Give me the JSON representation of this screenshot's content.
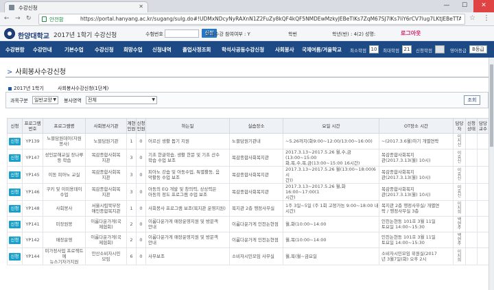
{
  "browser": {
    "tab_title": "수강신청",
    "secure_label": "안전함",
    "url": "https://portal.hanyang.ac.kr/sugang/sulg.do#!UDMxNDcyNyRAXnN1Z2FuZy8kQF4kQF5NMDEwMzkyJEBeTlKs7ZqM67SJ7lKs7liY6rCV7lug7LKtJEBeTTAwOTg4MiRAX",
    "back": "←",
    "forward": "→",
    "reload": "↻",
    "star": "☆",
    "menu": "⋮",
    "minimize": "—",
    "maximize": "☐",
    "close": "✕"
  },
  "header": {
    "university": "한양대학교",
    "semester_title": "2017년 1학기 수강신청",
    "student_no_label": "수험번호",
    "student_no_value": "",
    "confirm_button": "신청",
    "mock_label": "모의수강 참여여부 : Y",
    "college_label": "학번",
    "grade_label": "학년(반) : 4(2)",
    "name_label": "성명:",
    "logout": "로그아웃"
  },
  "mainnav": {
    "items": [
      "수강편람",
      "수강안내",
      "기본수업",
      "수강신청",
      "희망수업",
      "신청내역",
      "졸업사정조회",
      "학석사공동수강신청",
      "사회봉사",
      "국제여름/겨울학교"
    ],
    "min_credit_label": "최소학점",
    "min_credit": "10",
    "max_credit_label": "최대학점",
    "max_credit": "21",
    "applied_label": "신청학점",
    "applied": "",
    "english_label": "영어등급",
    "english": "B등급"
  },
  "page": {
    "title": "사회봉사수강신청",
    "title_arrow": ">",
    "year": "2017년 1학기",
    "sub": "사회봉사수강신청(1단계)",
    "filter1_label": "과목구분",
    "filter1_value": "일반교양",
    "filter2_label": "봉사영역",
    "filter2_value": "전체",
    "query_button": "조회"
  },
  "table": {
    "headers": [
      "신청",
      "프로그램\n번호",
      "프로그램명",
      "사회봉사기관",
      "계현\n인원",
      "신청\n인원",
      "하는일",
      "실습장소",
      "요일 시간",
      "OT장소 시간",
      "담당\n자",
      "신청\n상태",
      "담당\n교수"
    ],
    "apply_label": "신청",
    "rows": [
      {
        "no": "YP139",
        "name": "노블담원데이(자원\n봉사)",
        "org": "노블담원기관",
        "cap": "1",
        "app": "0",
        "task": "어르신 생활 돕기 지원",
        "place": "노블담원기관내",
        "time": "~5.26까지(화9:00~12:00/13:00~16:00)",
        "ot": "~(2017.3.6월)하기 개별연락",
        "mgr": "이\n지\n선"
      },
      {
        "no": "YP147",
        "name": "성인문해교실 장나루\n등 학습",
        "org": "목감종합사회복\n지관",
        "cap": "3",
        "app": "0",
        "task": "기초 한글학습, 생활 한문 및 기초 산수\n학습 수업 보조",
        "place": "목감종합사회복지관",
        "time": "2017.3.13~2017.5.26 월,수,금(13:00~15:00\n화,목,수,목,금(13:00~15:00 16시간)",
        "ot": "목감종합사회복지\n관(2017.3.13(월) 10시)",
        "mgr": "이\n효\n신"
      },
      {
        "no": "YP145",
        "name": "이동 피아노 교실",
        "org": "목감종합사회복\n지관",
        "cap": "3",
        "app": "0",
        "task": "피아노 강습 및 아동수업, 특별활동, 음\n악활동 수업 보조",
        "place": "목감종합사회복지관",
        "time": "2017.3.13~2017.5.26 월(13:00~18:00(6시\n간))",
        "ot": "목감종합사회복지\n관(2017.3.13(월) 10시)",
        "mgr": "이\n효\n신"
      },
      {
        "no": "YP146",
        "name": "쿠키 및 이미용데이\n수업",
        "org": "목감종합사회복\n지관",
        "cap": "3",
        "app": "0",
        "task": "아동의 EQ 개발 및 창의력, 상상력은\n아동의 정도 프로그램 수업 보조",
        "place": "목감종합사회복지관",
        "time": "2017.3.13~2017.5.26 월,화 16:00~17:00(1\n시간)",
        "ot": "목감종합사회복지\n관(2017.3.13(월) 10시)",
        "mgr": "이\n효\n신"
      },
      {
        "no": "YP148",
        "name": "사회봉사",
        "org": "서울시립북부장\n애인종합복지관",
        "cap": "1",
        "app": "0",
        "task": "사회봉사 프로그램 보조(복지관 운영지원)",
        "place": "복지관 2층 행정사무실",
        "time": "1주 3일~5일 (주 1회 고정가능 9:00~18:00 내\n시간)",
        "ot": "복지관 2층 행정사무실/ 개별연\n락 / 행정사무실 3층",
        "mgr": "이\n지\n희"
      },
      {
        "no": "YP141",
        "name": "미장원봉",
        "org": "이룸다운가게(국\n제협회)",
        "cap": "2",
        "app": "0",
        "task": "이룸다운가게 매장운영지원 및 방문객\n안내",
        "place": "이룸다운가게 인천논현점",
        "time": "월,화(10:00~14:00",
        "ot": "인천논현동 101호 3월 11일\n토요일 14:00~15:30",
        "mgr": "백\n현\n주"
      },
      {
        "no": "YP142",
        "name": "매장운영",
        "org": "이룸다운가게(국\n제협회)",
        "cap": "2",
        "app": "0",
        "task": "이룸다운가게 매장운영지원 및 방문객\n안내",
        "place": "이룸다운가게 인천논현점",
        "time": "월,목(10:00~14:00",
        "ot": "인천논현동 101호 3월 11일\n토요일 14:00~15:30",
        "mgr": "백\n현\n주"
      },
      {
        "no": "YP144",
        "name": "미가정사업 프로젝트에\n뉴스기자가지원",
        "org": "안산소비자시민\n모임",
        "cap": "6",
        "app": "0",
        "task": "사무보조",
        "place": "소비자시민모임 사무실",
        "time": "월,목(월~금요일",
        "ot": "소비자시민모임 위원실(2017\n년 3월7일(화) 오후 2시",
        "mgr": "이\n지\n희"
      }
    ]
  }
}
